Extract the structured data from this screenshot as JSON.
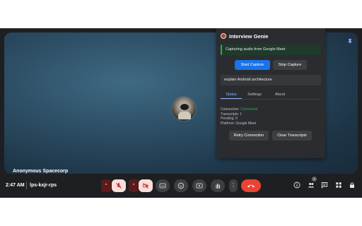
{
  "participant": {
    "name": "Anonymous Spacecorp"
  },
  "genie": {
    "title": "Interview Genie",
    "status": "Capturing audio from Google Meet",
    "start_label": "Start Capture",
    "stop_label": "Stop Capture",
    "query": "explain Android architecture",
    "tabs": [
      "Status",
      "Settings",
      "About"
    ],
    "connection_label": "Connection: ",
    "connection_value": "Connected",
    "transcripts": "Transcripts: 1",
    "pending": "Pending: 0",
    "platform": "Platform: Google Meet",
    "retry_label": "Retry Connection",
    "clear_label": "Clear Transcripts"
  },
  "meeting": {
    "time": "2:47 AM",
    "code": "lps-kxjr-rps",
    "people_count": "1"
  },
  "icons": {
    "mic_off": "mic-off-icon",
    "cam_off": "camera-off-icon",
    "captions": "captions-icon",
    "emoji": "emoji-icon",
    "present": "present-icon",
    "hand": "raise-hand-icon",
    "more": "more-options-icon",
    "leave": "leave-call-icon",
    "info": "info-icon",
    "people": "people-icon",
    "chat": "chat-icon",
    "activities": "activities-icon",
    "host": "host-controls-icon",
    "pin": "pin-icon"
  },
  "colors": {
    "accent": "#8ab4f8",
    "primary_button": "#1a73e8",
    "connected": "#34a853",
    "leave": "#ea4335",
    "alert_bg": "#f9dedc"
  }
}
